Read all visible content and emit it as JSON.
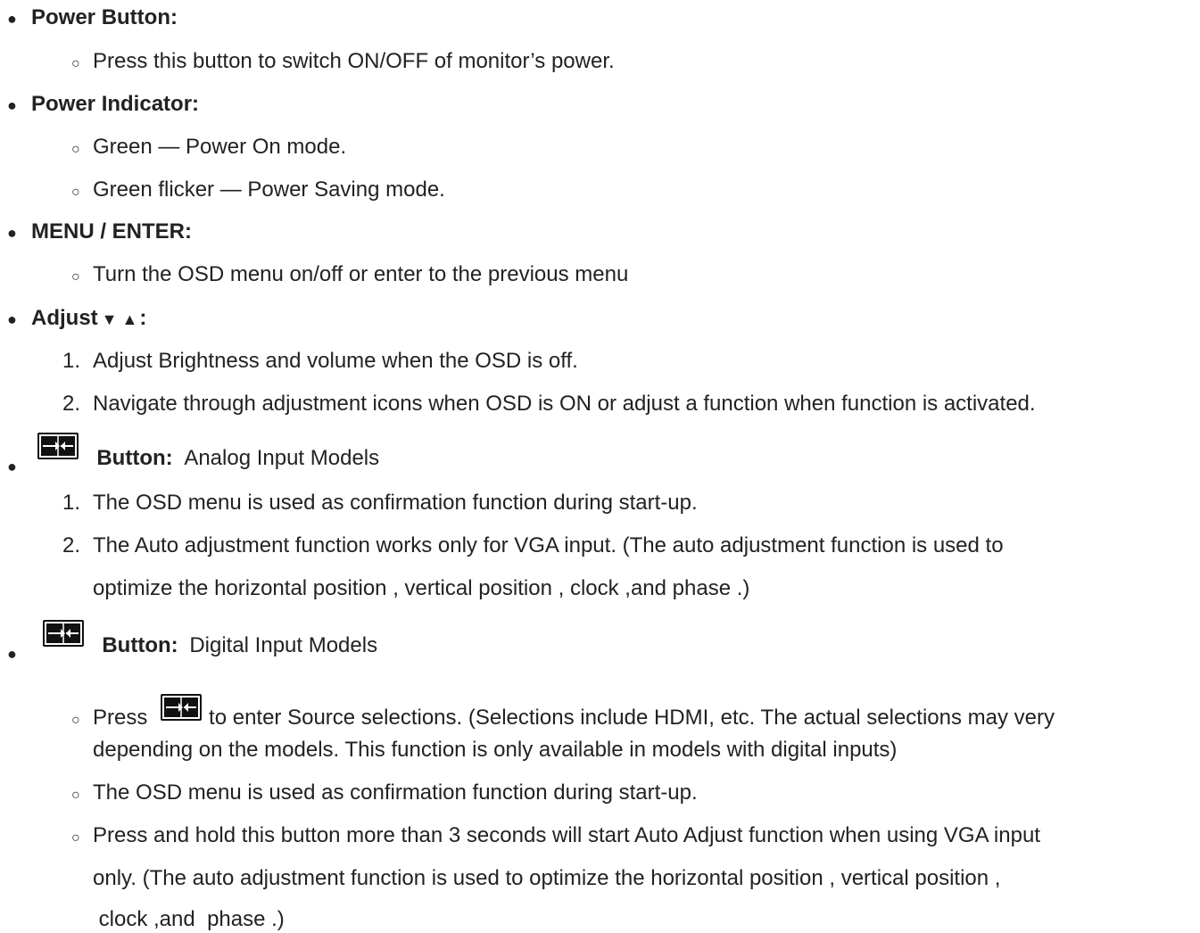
{
  "power_button": {
    "heading": "Power Button:",
    "items": [
      "Press this button to switch ON/OFF of monitor’s power."
    ]
  },
  "power_indicator": {
    "heading": "Power Indicator:",
    "items": [
      "Green — Power On mode.",
      "Green flicker — Power Saving mode."
    ]
  },
  "menu_enter": {
    "heading": "MENU / ENTER:",
    "items": [
      "Turn the OSD menu on/off or enter to the previous menu"
    ]
  },
  "adjust": {
    "heading": "Adjust",
    "arrows": "▼ ▲",
    "colon": ":",
    "items": [
      "Adjust Brightness and volume when the OSD is off.",
      "Navigate through adjustment icons when OSD is ON or adjust a function when function is activated."
    ]
  },
  "analog": {
    "icon": "source-button-icon",
    "heading": "Button:",
    "subtitle": "Analog Input Models",
    "item1": "The OSD menu is used as confirmation function during start-up.",
    "item2_line1": "The  Auto adjustment  function works only for VGA input. (The auto adjustment function is used to",
    "item2_line2": "optimize the  horizontal position ,  vertical position , clock ,and  phase .)"
  },
  "digital": {
    "icon": "source-button-icon",
    "heading": "Button:",
    "subtitle": "Digital Input Models",
    "item1_pre": "Press",
    "item1_post": "to enter Source selections. (Selections include HDMI, etc. The actual selections may very",
    "item1_line2": "depending on the models. This function is only available in models with digital inputs)",
    "item2": "The OSD menu is used as confirmation function during start-up.",
    "item3_line1": "Press and hold this button more than 3 seconds will start  Auto Adjust  function when using VGA input",
    "item3_line2": "only. (The auto adjustment function is used to optimize the  horizontal position ,  vertical position ,",
    "item3_line3": " clock ,and  phase .)"
  },
  "numbers": [
    "1.",
    "2."
  ]
}
